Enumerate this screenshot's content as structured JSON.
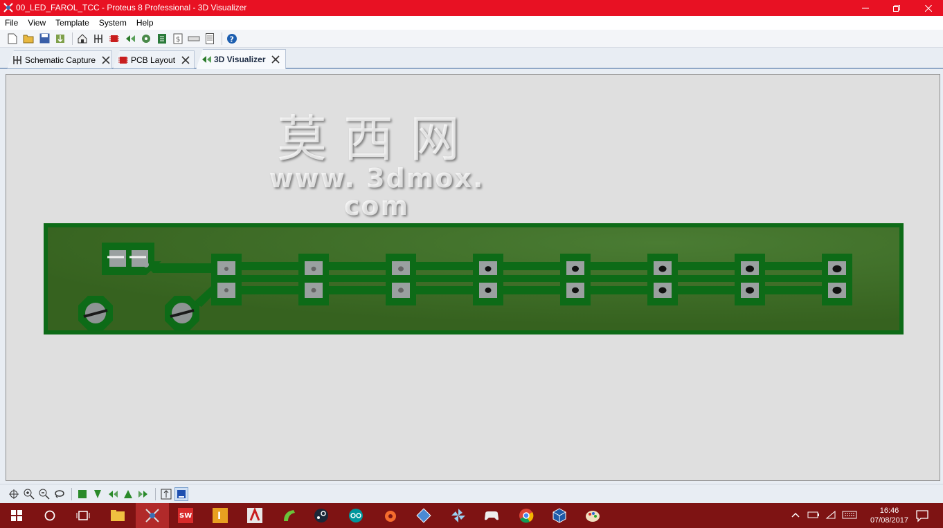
{
  "window": {
    "title": "00_LED_FAROL_TCC - Proteus 8 Professional - 3D Visualizer",
    "controls": [
      "minimize-icon",
      "restore-icon",
      "close-icon"
    ]
  },
  "menu": {
    "items": [
      "File",
      "View",
      "Template",
      "System",
      "Help"
    ]
  },
  "toolbar": {
    "icons": [
      "new-file-icon",
      "open-folder-icon",
      "save-icon",
      "import-icon",
      "home-icon",
      "schematic-icon",
      "pcb-icon",
      "3d-visualizer-icon",
      "gerber-icon",
      "bom-icon",
      "design-explorer-icon",
      "netlist-icon",
      "notes-icon",
      "help-icon"
    ]
  },
  "tabs": [
    {
      "label": "Schematic Capture",
      "active": false
    },
    {
      "label": "PCB Layout",
      "active": false
    },
    {
      "label": "3D Visualizer",
      "active": true
    }
  ],
  "watermark": {
    "cn": "莫西网",
    "url": "www. 3dmox. com"
  },
  "board": {
    "color": "#3d6b2a",
    "led_count": 8
  },
  "bottom_toolbar": {
    "icons": [
      "pan-icon",
      "zoom-in-icon",
      "zoom-out-icon",
      "rotate-icon",
      "top-view-icon",
      "front-view-icon",
      "left-view-icon",
      "back-view-icon",
      "right-view-icon",
      "height-icon",
      "board-view-icon"
    ]
  },
  "taskbar": {
    "apps": [
      "start-icon",
      "cortana-icon",
      "task-view-icon",
      "file-explorer-icon",
      "proteus-icon",
      "solidworks-icon",
      "inventor-icon",
      "autocad-icon",
      "app-green-icon",
      "steam-icon",
      "arduino-icon",
      "origin-icon",
      "network-app-icon",
      "pinwheel-icon",
      "gamepad-icon",
      "chrome-icon",
      "virtualbox-icon",
      "paint-icon"
    ],
    "time": "16:46",
    "date": "07/08/2017"
  }
}
